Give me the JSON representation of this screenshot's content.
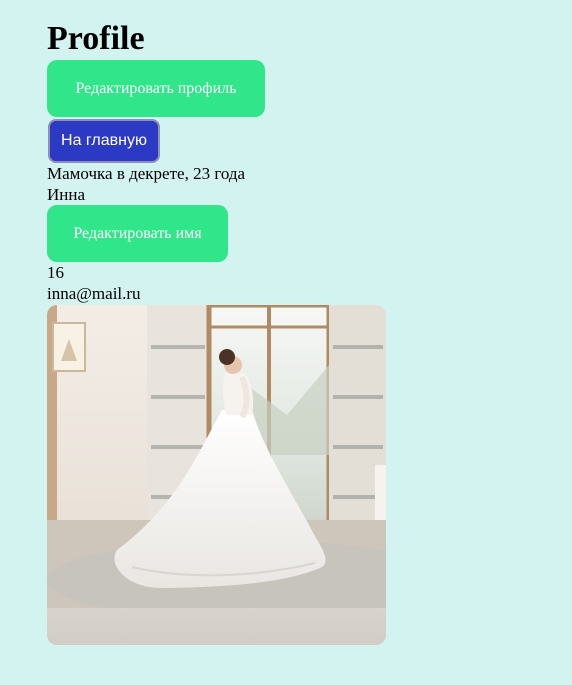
{
  "page": {
    "title": "Profile",
    "edit_profile_label": "Редактировать профиль",
    "home_label": "На главную",
    "status": "Мамочка в декрете, 23 года",
    "name": "Инна",
    "edit_name_label": "Редактировать имя",
    "age": "16",
    "email": "inna@mail.ru"
  },
  "colors": {
    "background": "#d3f3f1",
    "green_button": "#31e58a",
    "blue_button": "#2c39c4"
  },
  "photo": {
    "icon": "profile-photo-bride"
  }
}
